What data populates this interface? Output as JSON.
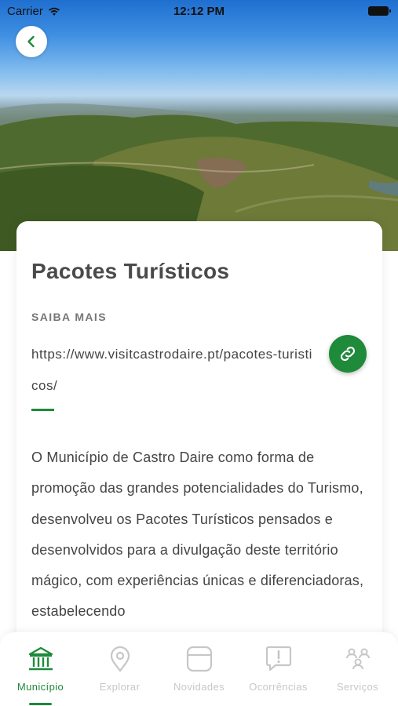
{
  "status_bar": {
    "carrier": "Carrier",
    "time": "12:12 PM"
  },
  "header": {
    "back_icon": "chevron-left-icon"
  },
  "content": {
    "title": "Pacotes Turísticos",
    "section_label": "SAIBA MAIS",
    "link_url": "https://www.visitcastrodaire.pt/pacotes-turisticos/",
    "link_icon": "link-icon",
    "description": "O Município de Castro Daire como forma de promoção das grandes potencialidades do Turismo, desenvolveu os Pacotes Turísticos pensados e desenvolvidos para a divulgação deste território mágico, com experiências únicas e diferenciadoras, estabelecendo"
  },
  "tab_bar": {
    "items": [
      {
        "label": "Município",
        "icon": "building-icon",
        "active": true
      },
      {
        "label": "Explorar",
        "icon": "map-pin-icon",
        "active": false
      },
      {
        "label": "Novidades",
        "icon": "news-icon",
        "active": false
      },
      {
        "label": "Ocorrências",
        "icon": "alert-message-icon",
        "active": false
      },
      {
        "label": "Serviços",
        "icon": "services-icon",
        "active": false
      }
    ]
  },
  "colors": {
    "accent": "#1e8a3a",
    "inactive": "#c7c7c7"
  }
}
